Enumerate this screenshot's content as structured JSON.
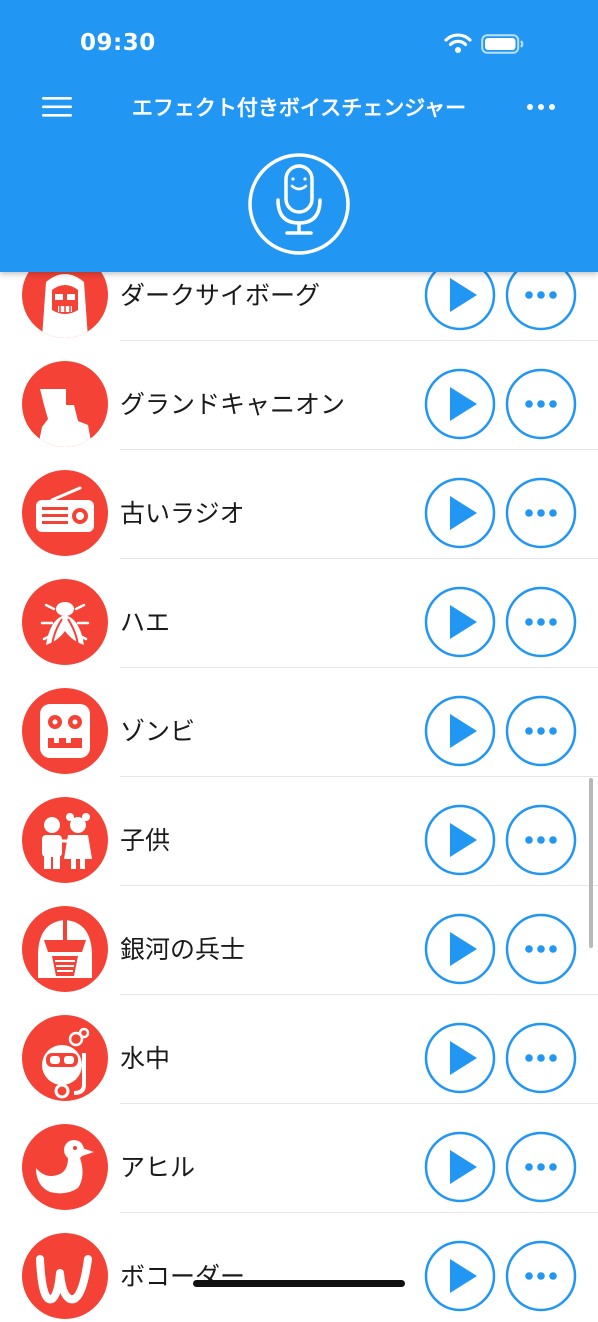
{
  "status_bar": {
    "time": "09:30"
  },
  "header": {
    "title": "エフェクト付きボイスチェンジャー",
    "menu_icon": "hamburger-menu-icon",
    "more_icon": "more-horizontal-icon",
    "mic_icon": "smiling-microphone-icon"
  },
  "colors": {
    "header": "#2196F3",
    "accent": "#2196F3",
    "avatar": "#F44336",
    "text": "#1a1a1a",
    "divider": "#e6e6e6"
  },
  "effects": [
    {
      "label": "ダークサイボーグ",
      "icon": "cyborg-skull-icon"
    },
    {
      "label": "グランドキャニオン",
      "icon": "canyon-mesa-icon"
    },
    {
      "label": "古いラジオ",
      "icon": "old-radio-icon"
    },
    {
      "label": "ハエ",
      "icon": "fly-icon"
    },
    {
      "label": "ゾンビ",
      "icon": "zombie-face-icon"
    },
    {
      "label": "子供",
      "icon": "children-icon"
    },
    {
      "label": "銀河の兵士",
      "icon": "galactic-soldier-helmet-icon"
    },
    {
      "label": "水中",
      "icon": "diver-mask-icon"
    },
    {
      "label": "アヒル",
      "icon": "duck-icon"
    },
    {
      "label": "ボコーダー",
      "icon": "vocoder-wave-icon"
    }
  ],
  "row_actions": {
    "play_icon": "play-icon",
    "options_icon": "more-dots-icon"
  }
}
